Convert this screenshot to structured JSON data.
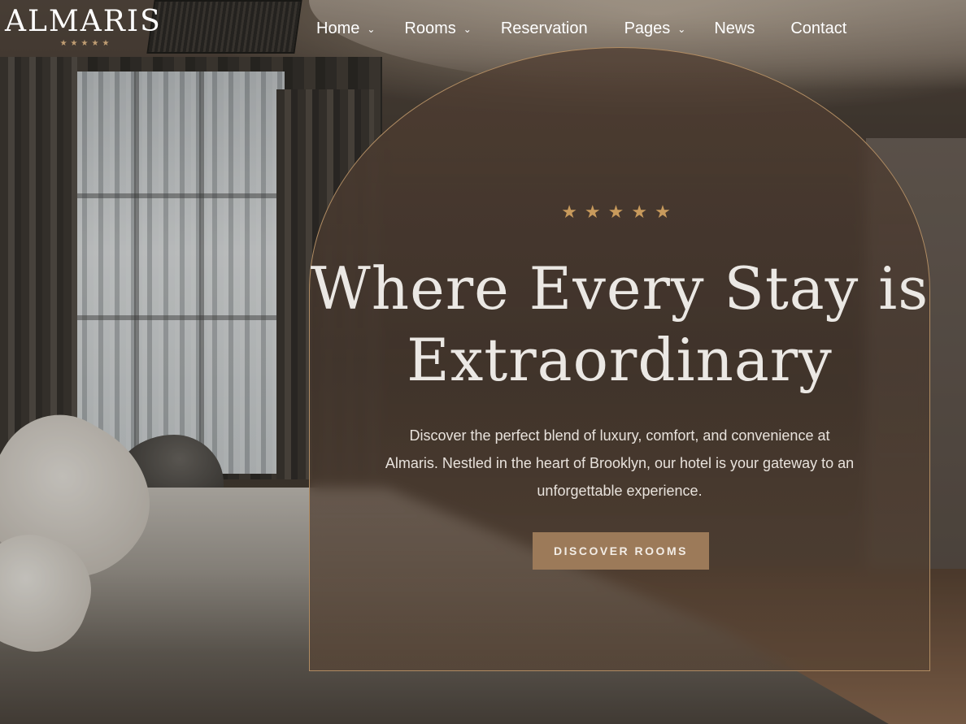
{
  "brand": {
    "name": "ALMARIS",
    "stars": "★★★★★"
  },
  "nav": {
    "items": [
      {
        "label": "Home",
        "has_dropdown": true
      },
      {
        "label": "Rooms",
        "has_dropdown": true
      },
      {
        "label": "Reservation",
        "has_dropdown": false
      },
      {
        "label": "Pages",
        "has_dropdown": true
      },
      {
        "label": "News",
        "has_dropdown": false
      },
      {
        "label": "Contact",
        "has_dropdown": false
      }
    ],
    "dropdown_icon": "chevron-down-icon"
  },
  "hero": {
    "stars": "★★★★★",
    "title_line1": "Where Every Stay is",
    "title_line2": "Extraordinary",
    "description": "Discover the perfect blend of luxury, comfort, and convenience at Almaris. Nestled in the heart of Brooklyn, our hotel is your gateway to an unforgettable experience.",
    "button_label": "DISCOVER ROOMS"
  },
  "colors": {
    "accent": "#9c7a59",
    "star": "#c89a5c",
    "text": "#ffffff"
  }
}
